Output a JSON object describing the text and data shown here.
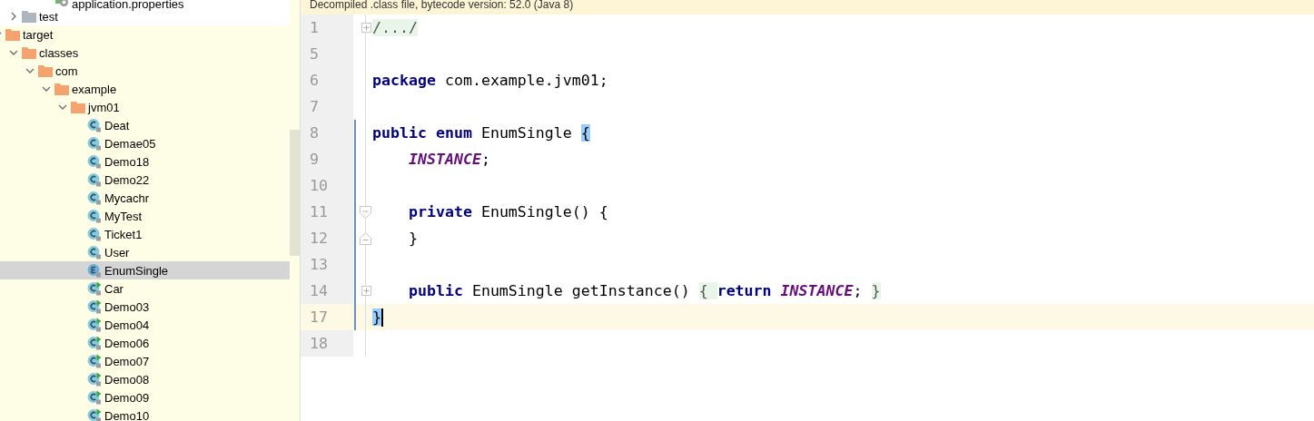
{
  "tree": [
    {
      "children": [
        {
          "children": [
            {
              "children": [
                {
                  "label": "application.properties",
                  "kind": "properties",
                  "selected": false
                }
              ]
            }
          ]
        },
        {
          "label": "test",
          "kind": "folder",
          "excluded": false,
          "expanded": false,
          "selected": false
        }
      ]
    },
    {
      "label": "target",
      "kind": "folder",
      "excluded": true,
      "expanded": true,
      "selected": false,
      "children": [
        {
          "label": "classes",
          "kind": "folder",
          "excluded": true,
          "expanded": true,
          "selected": false,
          "children": [
            {
              "label": "com",
              "kind": "folder",
              "excluded": true,
              "expanded": true,
              "selected": false,
              "children": [
                {
                  "label": "example",
                  "kind": "folder",
                  "excluded": true,
                  "expanded": true,
                  "selected": false,
                  "children": [
                    {
                      "label": "jvm01",
                      "kind": "folder",
                      "excluded": true,
                      "expanded": true,
                      "selected": false,
                      "children": [
                        {
                          "label": "Deat",
                          "kind": "class",
                          "selected": false
                        },
                        {
                          "label": "Demae05",
                          "kind": "class",
                          "selected": false
                        },
                        {
                          "label": "Demo18",
                          "kind": "class",
                          "selected": false
                        },
                        {
                          "label": "Demo22",
                          "kind": "class",
                          "selected": false
                        },
                        {
                          "label": "Mycachr",
                          "kind": "class",
                          "selected": false
                        },
                        {
                          "label": "MyTest",
                          "kind": "class",
                          "selected": false
                        },
                        {
                          "label": "Ticket1",
                          "kind": "class",
                          "selected": false
                        },
                        {
                          "label": "User",
                          "kind": "class",
                          "selected": false
                        },
                        {
                          "label": "EnumSingle",
                          "kind": "enum",
                          "selected": true
                        },
                        {
                          "label": "Car",
                          "kind": "main-class",
                          "selected": false
                        },
                        {
                          "label": "Demo03",
                          "kind": "main-class",
                          "selected": false
                        },
                        {
                          "label": "Demo04",
                          "kind": "main-class",
                          "selected": false
                        },
                        {
                          "label": "Demo06",
                          "kind": "main-class",
                          "selected": false
                        },
                        {
                          "label": "Demo07",
                          "kind": "main-class",
                          "selected": false
                        },
                        {
                          "label": "Demo08",
                          "kind": "main-class",
                          "selected": false
                        },
                        {
                          "label": "Demo09",
                          "kind": "main-class",
                          "selected": false
                        },
                        {
                          "label": "Demo10",
                          "kind": "main-class",
                          "selected": false
                        }
                      ]
                    }
                  ]
                }
              ]
            }
          ]
        }
      ]
    }
  ],
  "editor": {
    "banner": "Decompiled .class file, bytecode version: 52.0 (Java 8)",
    "lines": [
      {
        "number": "1",
        "kind": "folded",
        "scope": false,
        "current": false,
        "tokens": [
          {
            "kind": "folded",
            "text": "/.../"
          }
        ]
      },
      {
        "number": "5",
        "kind": "plain",
        "scope": false,
        "current": false
      },
      {
        "number": "6",
        "kind": "plain",
        "scope": false,
        "current": false,
        "tokens": [
          {
            "kind": "keyword",
            "text": "package"
          },
          {
            "kind": "text",
            "text": " com.example.jvm01;"
          }
        ]
      },
      {
        "number": "7",
        "kind": "plain",
        "scope": false,
        "current": false
      },
      {
        "number": "8",
        "kind": "plain",
        "scope": true,
        "current": false,
        "tokens": [
          {
            "kind": "keyword",
            "text": "public enum"
          },
          {
            "kind": "text",
            "text": " EnumSingle "
          },
          {
            "kind": "match",
            "text": "{"
          }
        ]
      },
      {
        "number": "9",
        "kind": "plain",
        "scope": true,
        "current": false,
        "tokens": [
          {
            "kind": "constant",
            "text": "    INSTANCE"
          },
          {
            "kind": "text",
            "text": ";"
          }
        ]
      },
      {
        "number": "10",
        "kind": "plain",
        "scope": true,
        "current": false
      },
      {
        "number": "11",
        "kind": "opener",
        "scope": true,
        "current": false,
        "tokens": [
          {
            "kind": "keyword",
            "text": "    private"
          },
          {
            "kind": "text",
            "text": " EnumSingle() {"
          }
        ]
      },
      {
        "number": "12",
        "kind": "closer",
        "scope": true,
        "current": false,
        "tokens": [
          {
            "kind": "text",
            "text": "    }"
          }
        ]
      },
      {
        "number": "13",
        "kind": "plain",
        "scope": true,
        "current": false
      },
      {
        "number": "14",
        "kind": "folded",
        "scope": true,
        "current": false,
        "tokens": [
          {
            "kind": "keyword",
            "text": "    public"
          },
          {
            "kind": "text",
            "text": " EnumSingle getInstance() "
          },
          {
            "kind": "folded",
            "text": "{ "
          },
          {
            "kind": "keyword",
            "text": "return"
          },
          {
            "kind": "constant",
            "text": " INSTANCE"
          },
          {
            "kind": "text",
            "text": "; "
          },
          {
            "kind": "folded",
            "text": "}"
          }
        ]
      },
      {
        "number": "17",
        "kind": "plain",
        "scope": true,
        "current": true,
        "caret": true,
        "tokens": [
          {
            "kind": "match",
            "text": "}"
          }
        ]
      },
      {
        "number": "18",
        "kind": "plain",
        "scope": false,
        "current": false
      }
    ]
  }
}
